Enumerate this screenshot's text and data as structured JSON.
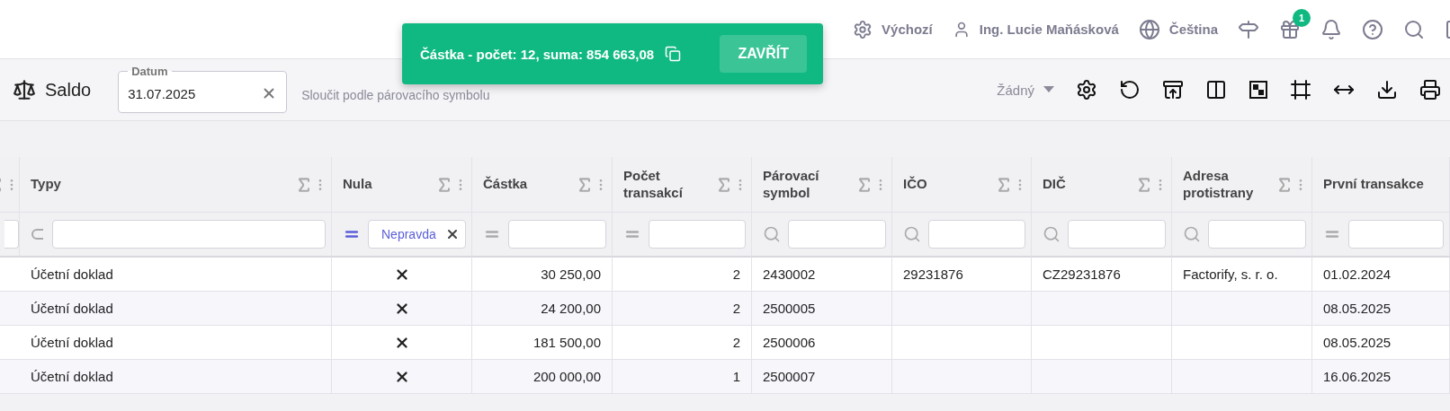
{
  "header": {
    "profile": "Výchozí",
    "user": "Ing. Lucie Maňásková",
    "language": "Čeština",
    "gift_badge": "1"
  },
  "toolbar": {
    "title": "Saldo",
    "date_field": {
      "label": "Datum",
      "value": "31.07.2025"
    },
    "merge_label": "Sloučit podle párovacího symbolu",
    "view_select": "Žádný"
  },
  "toast": {
    "text": "Částka - počet: 12, suma: 854 663,08",
    "button": "ZAVŘÍT"
  },
  "table": {
    "columns": [
      {
        "kind": "plain",
        "sum": true
      },
      {
        "label": "Typy",
        "kind": "contains",
        "sum": true
      },
      {
        "label": "Nula",
        "kind": "equals",
        "filter_value": "Nepravda",
        "sum": true
      },
      {
        "label": "Částka",
        "kind": "equals",
        "sum": true
      },
      {
        "label": "Počet transakcí",
        "kind": "equals",
        "sum": true
      },
      {
        "label": "Párovací symbol",
        "kind": "search",
        "sum": true
      },
      {
        "label": "IČO",
        "kind": "search",
        "sum": true
      },
      {
        "label": "DIČ",
        "kind": "search",
        "sum": true
      },
      {
        "label": "Adresa protistrany",
        "kind": "search",
        "sum": true
      },
      {
        "label": "První transakce",
        "kind": "equals",
        "sum": false
      }
    ],
    "rows": [
      {
        "type": "Účetní doklad",
        "zero": false,
        "amount": "30 250,00",
        "count": "2",
        "symbol": "2430002",
        "ico": "29231876",
        "dic": "CZ29231876",
        "address": "Factorify, s. r. o.",
        "first": "01.02.2024"
      },
      {
        "type": "Účetní doklad",
        "zero": false,
        "amount": "24 200,00",
        "count": "2",
        "symbol": "2500005",
        "first": "08.05.2025"
      },
      {
        "type": "Účetní doklad",
        "zero": false,
        "amount": "181 500,00",
        "count": "2",
        "symbol": "2500006",
        "first": "08.05.2025"
      },
      {
        "type": "Účetní doklad",
        "zero": false,
        "amount": "200 000,00",
        "count": "1",
        "symbol": "2500007",
        "first": "16.06.2025"
      }
    ]
  }
}
